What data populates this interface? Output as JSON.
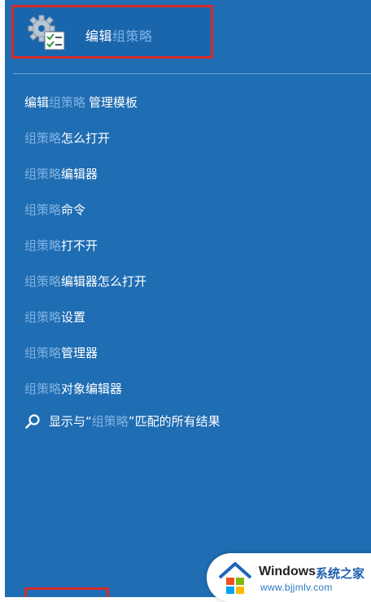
{
  "top_result": {
    "label_bold": "编辑",
    "label_faded": "组策略"
  },
  "suggestions": [
    {
      "faded_prefix": "",
      "bold_part": "编辑",
      "faded_part": "组策略",
      "suffix": "管理模板"
    },
    {
      "faded_prefix": "组策略",
      "bold_part": "",
      "faded_part": "",
      "suffix": "怎么打开"
    },
    {
      "faded_prefix": "组策略",
      "bold_part": "",
      "faded_part": "",
      "suffix": "编辑器"
    },
    {
      "faded_prefix": "组策略",
      "bold_part": "",
      "faded_part": "",
      "suffix": "命令"
    },
    {
      "faded_prefix": "组策略",
      "bold_part": "",
      "faded_part": "",
      "suffix": "打不开"
    },
    {
      "faded_prefix": "组策略",
      "bold_part": "",
      "faded_part": "",
      "suffix": "编辑器怎么打开"
    },
    {
      "faded_prefix": "组策略",
      "bold_part": "",
      "faded_part": "",
      "suffix": "设置"
    },
    {
      "faded_prefix": "组策略",
      "bold_part": "",
      "faded_part": "",
      "suffix": "管理器"
    },
    {
      "faded_prefix": "组策略",
      "bold_part": "",
      "faded_part": "",
      "suffix": "对象编辑器"
    }
  ],
  "web_search": {
    "prefix": "显示与“",
    "term": "组策略",
    "suffix": "”匹配的所有结果"
  },
  "watermark": {
    "title": "Windows",
    "title_cn": "系统之家",
    "url": "www.bjjmlv.com"
  },
  "colors": {
    "panel_background": "#1f6db3",
    "highlight_border": "#d42a2a",
    "faded_text": "#7fb3e2"
  }
}
